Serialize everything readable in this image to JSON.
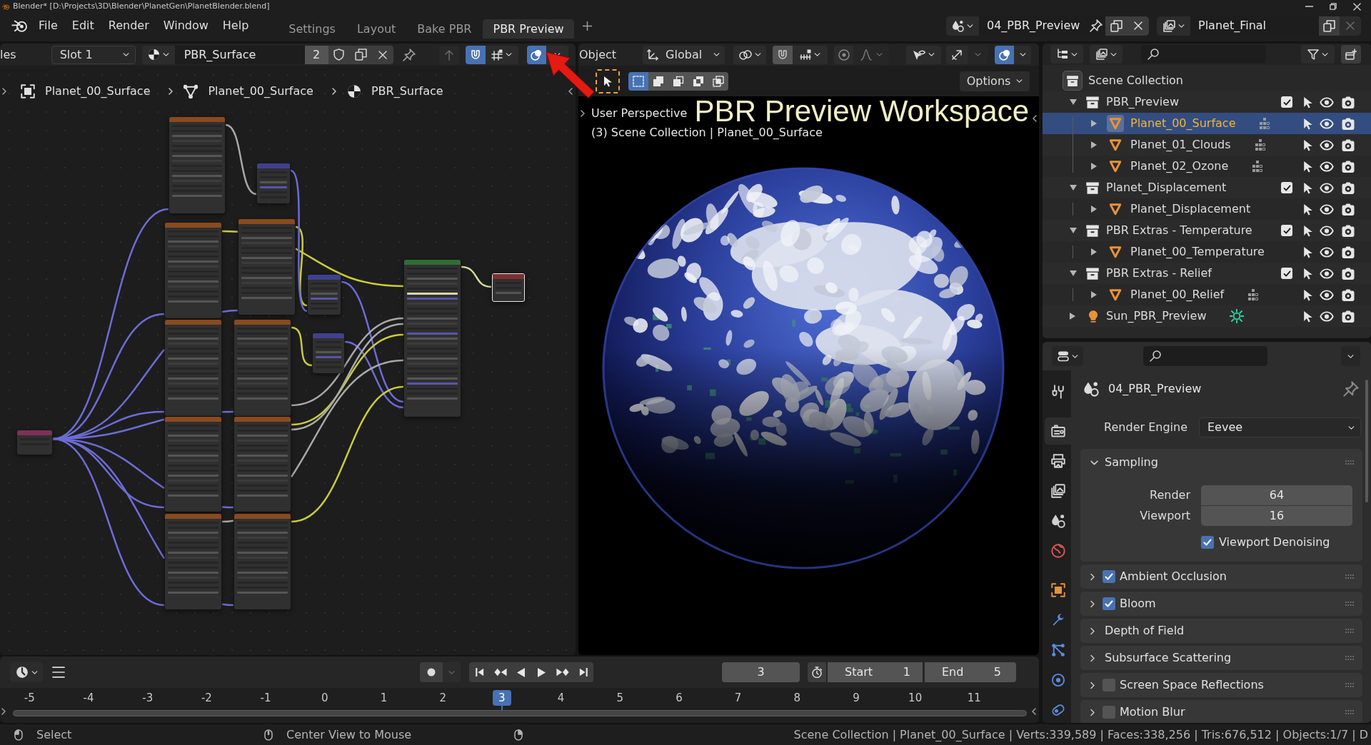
{
  "title_bar": {
    "title": "Blender* [D:\\Projects\\3D\\Blender\\PlanetGen\\PlanetBlender.blend]"
  },
  "menu": [
    "File",
    "Edit",
    "Render",
    "Window",
    "Help"
  ],
  "workspaces": [
    {
      "label": "Settings",
      "selected": false
    },
    {
      "label": "Layout",
      "selected": false
    },
    {
      "label": "Bake PBR",
      "selected": false
    },
    {
      "label": "PBR Preview",
      "selected": true
    }
  ],
  "scene": {
    "name": "04_PBR_Preview"
  },
  "view_layer": {
    "name": "Planet_Final"
  },
  "node_editor": {
    "header": {
      "partial_label": "les",
      "slot": "Slot 1",
      "material": "PBR_Surface",
      "users": "2",
      "snap": true,
      "overlays": true
    },
    "breadcrumbs": [
      {
        "kind": "object",
        "label": "Planet_00_Surface"
      },
      {
        "kind": "mesh",
        "label": "Planet_00_Surface"
      },
      {
        "kind": "material",
        "label": "PBR_Surface"
      }
    ]
  },
  "viewport": {
    "header": {
      "menu": "Object",
      "orientation": "Global",
      "overlays": true
    },
    "select_modes": [
      {
        "kind": "set",
        "selected": true
      },
      {
        "kind": "extend",
        "selected": false
      },
      {
        "kind": "subtract",
        "selected": false
      },
      {
        "kind": "invert",
        "selected": false
      },
      {
        "kind": "intersect",
        "selected": false
      }
    ],
    "options": "Options",
    "view_name": "User Perspective",
    "view_info": "(3) Scene Collection | Planet_00_Surface",
    "caption": "PBR Preview Workspace"
  },
  "outliner": {
    "root": "Scene Collection",
    "items": [
      {
        "kind": "collection",
        "label": "PBR_Preview",
        "expanded": true,
        "selected": false,
        "checked": true,
        "children": [
          {
            "kind": "mesh",
            "label": "Planet_00_Surface",
            "expanded": false,
            "selected": true,
            "modifiers": true
          },
          {
            "kind": "mesh",
            "label": "Planet_01_Clouds",
            "expanded": false,
            "selected": false,
            "modifiers": true
          },
          {
            "kind": "mesh",
            "label": "Planet_02_Ozone",
            "expanded": false,
            "selected": false,
            "modifiers": true
          }
        ]
      },
      {
        "kind": "collection",
        "label": "Planet_Displacement",
        "expanded": true,
        "selected": false,
        "checked": true,
        "children": [
          {
            "kind": "mesh",
            "label": "Planet_Displacement",
            "expanded": false,
            "selected": false,
            "modifiers": false
          }
        ]
      },
      {
        "kind": "collection",
        "label": "PBR Extras - Temperature",
        "expanded": true,
        "selected": false,
        "checked": true,
        "children": [
          {
            "kind": "mesh",
            "label": "Planet_00_Temperature",
            "expanded": false,
            "selected": false,
            "modifiers": false
          }
        ]
      },
      {
        "kind": "collection",
        "label": "PBR Extras - Relief",
        "expanded": true,
        "selected": false,
        "checked": true,
        "children": [
          {
            "kind": "mesh",
            "label": "Planet_00_Relief",
            "expanded": false,
            "selected": false,
            "modifiers": true
          }
        ]
      },
      {
        "kind": "light",
        "label": "Sun_PBR_Preview",
        "expanded": false,
        "selected": false
      }
    ]
  },
  "properties": {
    "tab_groups": [
      [
        {
          "kind": "tool",
          "selected": false
        }
      ],
      [
        {
          "kind": "render",
          "selected": true
        },
        {
          "kind": "output",
          "selected": false
        },
        {
          "kind": "view_layer",
          "selected": false
        },
        {
          "kind": "scene",
          "selected": false
        },
        {
          "kind": "world",
          "selected": false
        }
      ],
      [
        {
          "kind": "object",
          "selected": false
        },
        {
          "kind": "modifiers",
          "selected": false
        },
        {
          "kind": "particles",
          "selected": false
        },
        {
          "kind": "physics",
          "selected": false
        },
        {
          "kind": "constraints",
          "selected": false
        }
      ]
    ],
    "context": "04_PBR_Preview",
    "render_engine": {
      "label": "Render Engine",
      "value": "Eevee"
    },
    "panels": [
      {
        "kind": "plain",
        "label": "Sampling",
        "expanded": true,
        "fields": [
          {
            "label": "Render",
            "value": "64"
          },
          {
            "label": "Viewport",
            "value": "16"
          }
        ],
        "options": [
          {
            "label": "Viewport Denoising",
            "checked": true
          }
        ]
      },
      {
        "kind": "toggle",
        "label": "Ambient Occlusion",
        "expanded": false,
        "checked": true
      },
      {
        "kind": "toggle",
        "label": "Bloom",
        "expanded": false,
        "checked": true
      },
      {
        "kind": "plain",
        "label": "Depth of Field",
        "expanded": false
      },
      {
        "kind": "plain",
        "label": "Subsurface Scattering",
        "expanded": false
      },
      {
        "kind": "toggle",
        "label": "Screen Space Reflections",
        "expanded": false,
        "checked": false
      },
      {
        "kind": "toggle",
        "label": "Motion Blur",
        "expanded": false,
        "checked": false
      }
    ]
  },
  "timeline": {
    "current_frame": "3",
    "start": {
      "label": "Start",
      "value": "1"
    },
    "end": {
      "label": "End",
      "value": "5"
    },
    "frames": [
      {
        "label": "-5",
        "selected": false
      },
      {
        "label": "-4",
        "selected": false
      },
      {
        "label": "-3",
        "selected": false
      },
      {
        "label": "-2",
        "selected": false
      },
      {
        "label": "-1",
        "selected": false
      },
      {
        "label": "0",
        "selected": false
      },
      {
        "label": "1",
        "selected": false
      },
      {
        "label": "2",
        "selected": false
      },
      {
        "label": "3",
        "selected": true
      },
      {
        "label": "4",
        "selected": false
      },
      {
        "label": "5",
        "selected": false
      },
      {
        "label": "6",
        "selected": false
      },
      {
        "label": "7",
        "selected": false
      },
      {
        "label": "8",
        "selected": false
      },
      {
        "label": "9",
        "selected": false
      },
      {
        "label": "10",
        "selected": false
      },
      {
        "label": "11",
        "selected": false
      }
    ]
  },
  "status_bar": {
    "hints": [
      {
        "kind": "left",
        "label": "Select"
      },
      {
        "kind": "middle",
        "label": "Center View to Mouse"
      },
      {
        "kind": "right"
      }
    ],
    "stats": "Scene Collection | Planet_00_Surface | Verts:339,589 | Faces:338,256 | Tris:676,512 | Objects:1/7 | D"
  }
}
